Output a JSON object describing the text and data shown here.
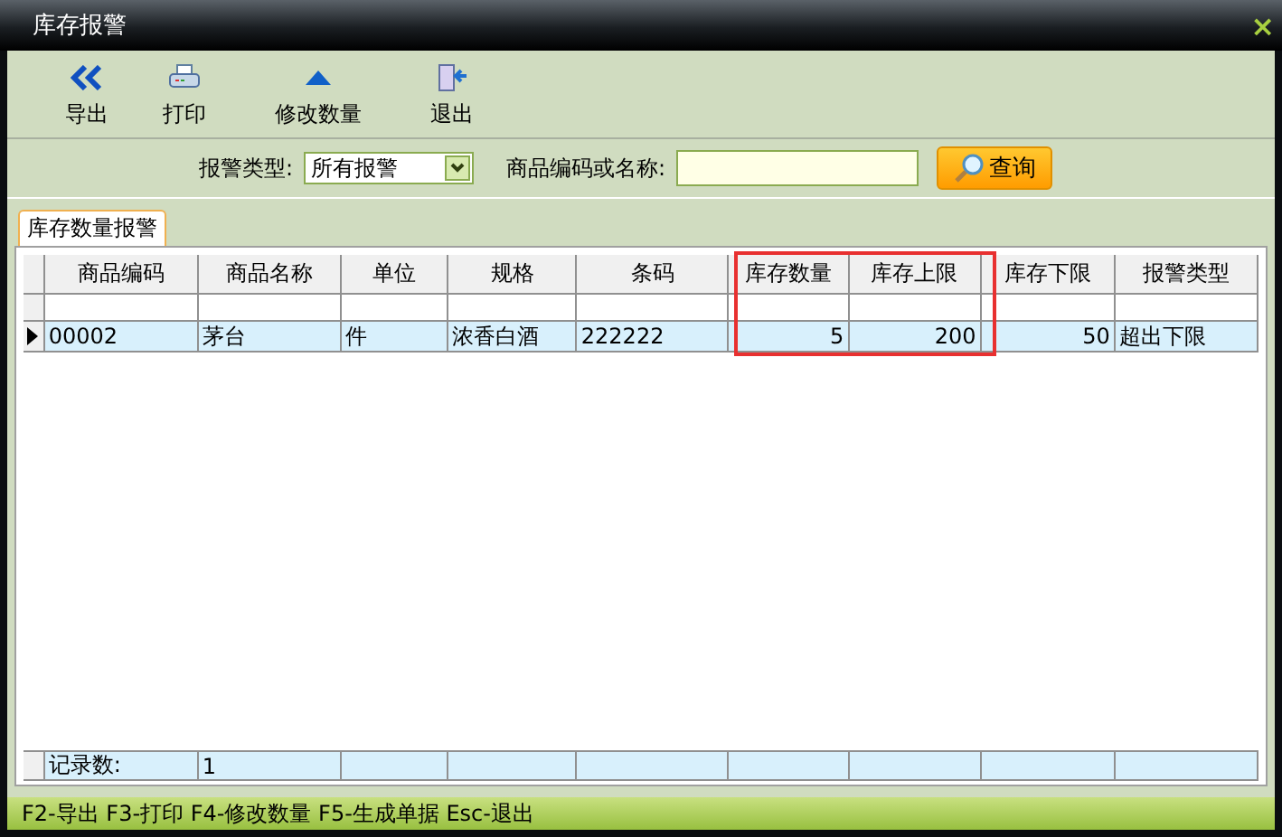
{
  "window": {
    "title": "库存报警",
    "close": "×"
  },
  "toolbar": [
    {
      "kind": "export",
      "label": "导出"
    },
    {
      "kind": "print",
      "label": "打印"
    },
    {
      "kind": "edit",
      "label": "修改数量"
    },
    {
      "kind": "exit",
      "label": "退出"
    }
  ],
  "filter": {
    "type_label": "报警类型:",
    "type_value": "所有报警",
    "search_label": "商品编码或名称:",
    "search_button": "查询"
  },
  "tabs": [
    {
      "label": "库存数量报警",
      "selected": true
    }
  ],
  "table": {
    "columns": [
      {
        "label": "商品编码",
        "highlighted": false
      },
      {
        "label": "商品名称",
        "highlighted": false
      },
      {
        "label": "单位",
        "highlighted": false
      },
      {
        "label": "规格",
        "highlighted": false
      },
      {
        "label": "条码",
        "highlighted": false
      },
      {
        "label": "库存数量",
        "highlighted": true
      },
      {
        "label": "库存上限",
        "highlighted": true
      },
      {
        "label": "库存下限",
        "highlighted": false
      },
      {
        "label": "报警类型",
        "highlighted": false
      }
    ],
    "rows": [
      {
        "selected": true,
        "cells": [
          "00002",
          "茅台",
          "件",
          "浓香白酒",
          "222222",
          "5",
          "200",
          "50",
          "超出下限"
        ]
      }
    ],
    "footer": [
      "记录数:",
      "1"
    ]
  },
  "status_bar": "F2-导出 F3-打印 F4-修改数量 F5-生成单据 Esc-退出"
}
